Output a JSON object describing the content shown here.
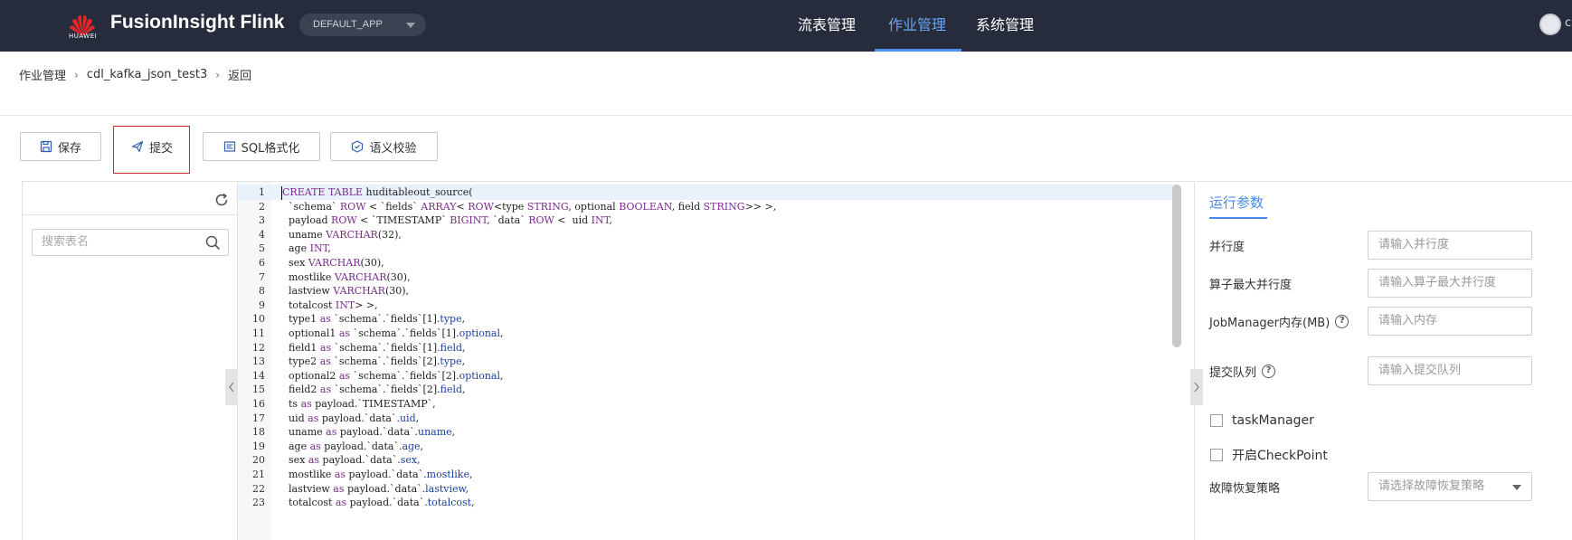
{
  "header": {
    "brand_sub": "HUAWEI",
    "app_title": "FusionInsight Flink",
    "app_selector": "DEFAULT_APP",
    "nav": [
      {
        "label": "流表管理"
      },
      {
        "label": "作业管理"
      },
      {
        "label": "系统管理"
      }
    ],
    "avatar_tail": "c"
  },
  "breadcrumb": [
    "作业管理",
    "cdl_kafka_json_test3",
    "返回"
  ],
  "toolbar": {
    "save_label": "保存",
    "submit_label": "提交",
    "format_label": "SQL格式化",
    "validate_label": "语义校验"
  },
  "left_panel": {
    "search_placeholder": "搜索表名"
  },
  "editor": {
    "lines": [
      "CREATE TABLE huditableout_source(",
      "  `schema` ROW < `fields` ARRAY< ROW<type STRING, optional BOOLEAN, field STRING>> >,",
      "  payload ROW < `TIMESTAMP` BIGINT, `data` ROW <  uid INT,",
      "  uname VARCHAR(32),",
      "  age INT,",
      "  sex VARCHAR(30),",
      "  mostlike VARCHAR(30),",
      "  lastview VARCHAR(30),",
      "  totalcost INT> >,",
      "  type1 as `schema`.`fields`[1].type,",
      "  optional1 as `schema`.`fields`[1].optional,",
      "  field1 as `schema`.`fields`[1].field,",
      "  type2 as `schema`.`fields`[2].type,",
      "  optional2 as `schema`.`fields`[2].optional,",
      "  field2 as `schema`.`fields`[2].field,",
      "  ts as payload.`TIMESTAMP`,",
      "  uid as payload.`data`.uid,",
      "  uname as payload.`data`.uname,",
      "  age as payload.`data`.age,",
      "  sex as payload.`data`.sex,",
      "  mostlike as payload.`data`.mostlike,",
      "  lastview as payload.`data`.lastview,",
      "  totalcost as payload.`data`.totalcost,"
    ]
  },
  "run_params": {
    "title": "运行参数",
    "parallelism_label": "并行度",
    "parallelism_placeholder": "请输入并行度",
    "max_parallelism_label": "算子最大并行度",
    "max_parallelism_placeholder": "请输入算子最大并行度",
    "jm_memory_label": "JobManager内存(MB)",
    "jm_memory_placeholder": "请输入内存",
    "queue_label": "提交队列",
    "queue_placeholder": "请输入提交队列",
    "task_manager_label": "taskManager",
    "checkpoint_label": "开启CheckPoint",
    "failover_label": "故障恢复策略",
    "failover_placeholder": "请选择故障恢复策略"
  }
}
